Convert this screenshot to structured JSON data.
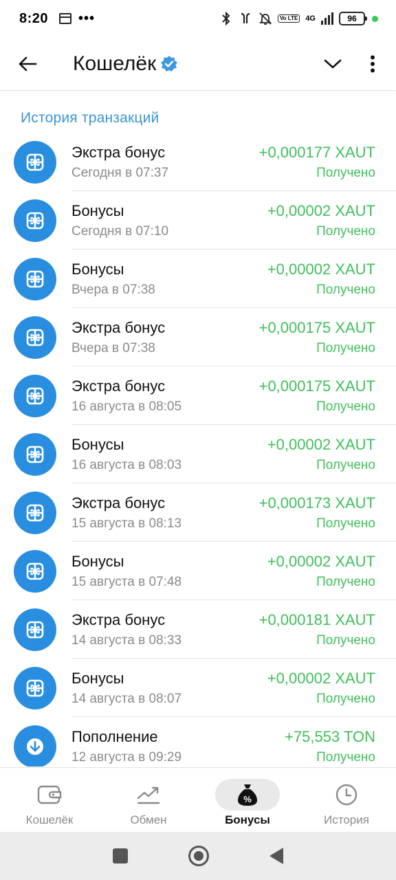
{
  "status_bar": {
    "time": "8:20",
    "dots": "•••",
    "network": "4G",
    "volte": "Vo LTE",
    "battery": "96"
  },
  "header": {
    "title": "Кошелёк"
  },
  "section_title": "История транзакций",
  "transactions": [
    {
      "name": "Экстра бонус",
      "date": "Сегодня в 07:37",
      "amount": "+0,000177 XAUT",
      "status": "Получено",
      "icon": "gift-icon"
    },
    {
      "name": "Бонусы",
      "date": "Сегодня в 07:10",
      "amount": "+0,00002 XAUT",
      "status": "Получено",
      "icon": "gift-icon"
    },
    {
      "name": "Бонусы",
      "date": "Вчера в 07:38",
      "amount": "+0,00002 XAUT",
      "status": "Получено",
      "icon": "gift-icon"
    },
    {
      "name": "Экстра бонус",
      "date": "Вчера в 07:38",
      "amount": "+0,000175 XAUT",
      "status": "Получено",
      "icon": "gift-icon"
    },
    {
      "name": "Экстра бонус",
      "date": "16 августа в 08:05",
      "amount": "+0,000175 XAUT",
      "status": "Получено",
      "icon": "gift-icon"
    },
    {
      "name": "Бонусы",
      "date": "16 августа в 08:03",
      "amount": "+0,00002 XAUT",
      "status": "Получено",
      "icon": "gift-icon"
    },
    {
      "name": "Экстра бонус",
      "date": "15 августа в 08:13",
      "amount": "+0,000173 XAUT",
      "status": "Получено",
      "icon": "gift-icon"
    },
    {
      "name": "Бонусы",
      "date": "15 августа в 07:48",
      "amount": "+0,00002 XAUT",
      "status": "Получено",
      "icon": "gift-icon"
    },
    {
      "name": "Экстра бонус",
      "date": "14 августа в 08:33",
      "amount": "+0,000181 XAUT",
      "status": "Получено",
      "icon": "gift-icon"
    },
    {
      "name": "Бонусы",
      "date": "14 августа в 08:07",
      "amount": "+0,00002 XAUT",
      "status": "Получено",
      "icon": "gift-icon"
    },
    {
      "name": "Пополнение",
      "date": "12 августа в 09:29",
      "amount": "+75,553 TON",
      "status": "Получено",
      "icon": "download-arrow-icon"
    }
  ],
  "bottom_nav": [
    {
      "label": "Кошелёк",
      "icon": "wallet-icon",
      "active": false
    },
    {
      "label": "Обмен",
      "icon": "chart-icon",
      "active": false
    },
    {
      "label": "Бонусы",
      "icon": "percent-bag-icon",
      "active": true
    },
    {
      "label": "История",
      "icon": "clock-icon",
      "active": false
    }
  ],
  "colors": {
    "accent_blue": "#2a8ee0",
    "section_title": "#3a95d6",
    "positive_green": "#3fbf5a",
    "secondary_text": "#8a8a8a"
  }
}
